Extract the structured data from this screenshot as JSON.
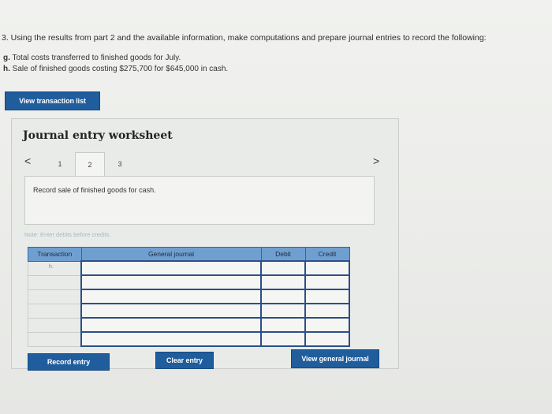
{
  "question": {
    "text": "3. Using the results from part 2 and the available information, make computations and prepare journal entries to record the following:",
    "items": [
      {
        "letter": "g.",
        "text": "Total costs transferred to finished goods for July."
      },
      {
        "letter": "h.",
        "text": "Sale of finished goods costing $275,700 for $645,000 in cash."
      }
    ]
  },
  "buttons": {
    "view_transaction_list": "View transaction list",
    "record_entry": "Record entry",
    "clear_entry": "Clear entry",
    "view_general_journal": "View general journal"
  },
  "worksheet": {
    "title": "Journal entry worksheet",
    "prev_icon": "<",
    "next_icon": ">",
    "tabs": [
      "1",
      "2",
      "3"
    ],
    "active_tab": "2",
    "entry_description": "Record sale of finished goods for cash.",
    "note": "Note: Enter debits before credits.",
    "table": {
      "headers": [
        "Transaction",
        "General journal",
        "Debit",
        "Credit"
      ],
      "rows": [
        {
          "transaction": "h."
        },
        {
          "transaction": ""
        },
        {
          "transaction": ""
        },
        {
          "transaction": ""
        },
        {
          "transaction": ""
        },
        {
          "transaction": ""
        }
      ]
    }
  },
  "colors": {
    "button": "#1f5d9c",
    "header": "#6f9fd0"
  }
}
